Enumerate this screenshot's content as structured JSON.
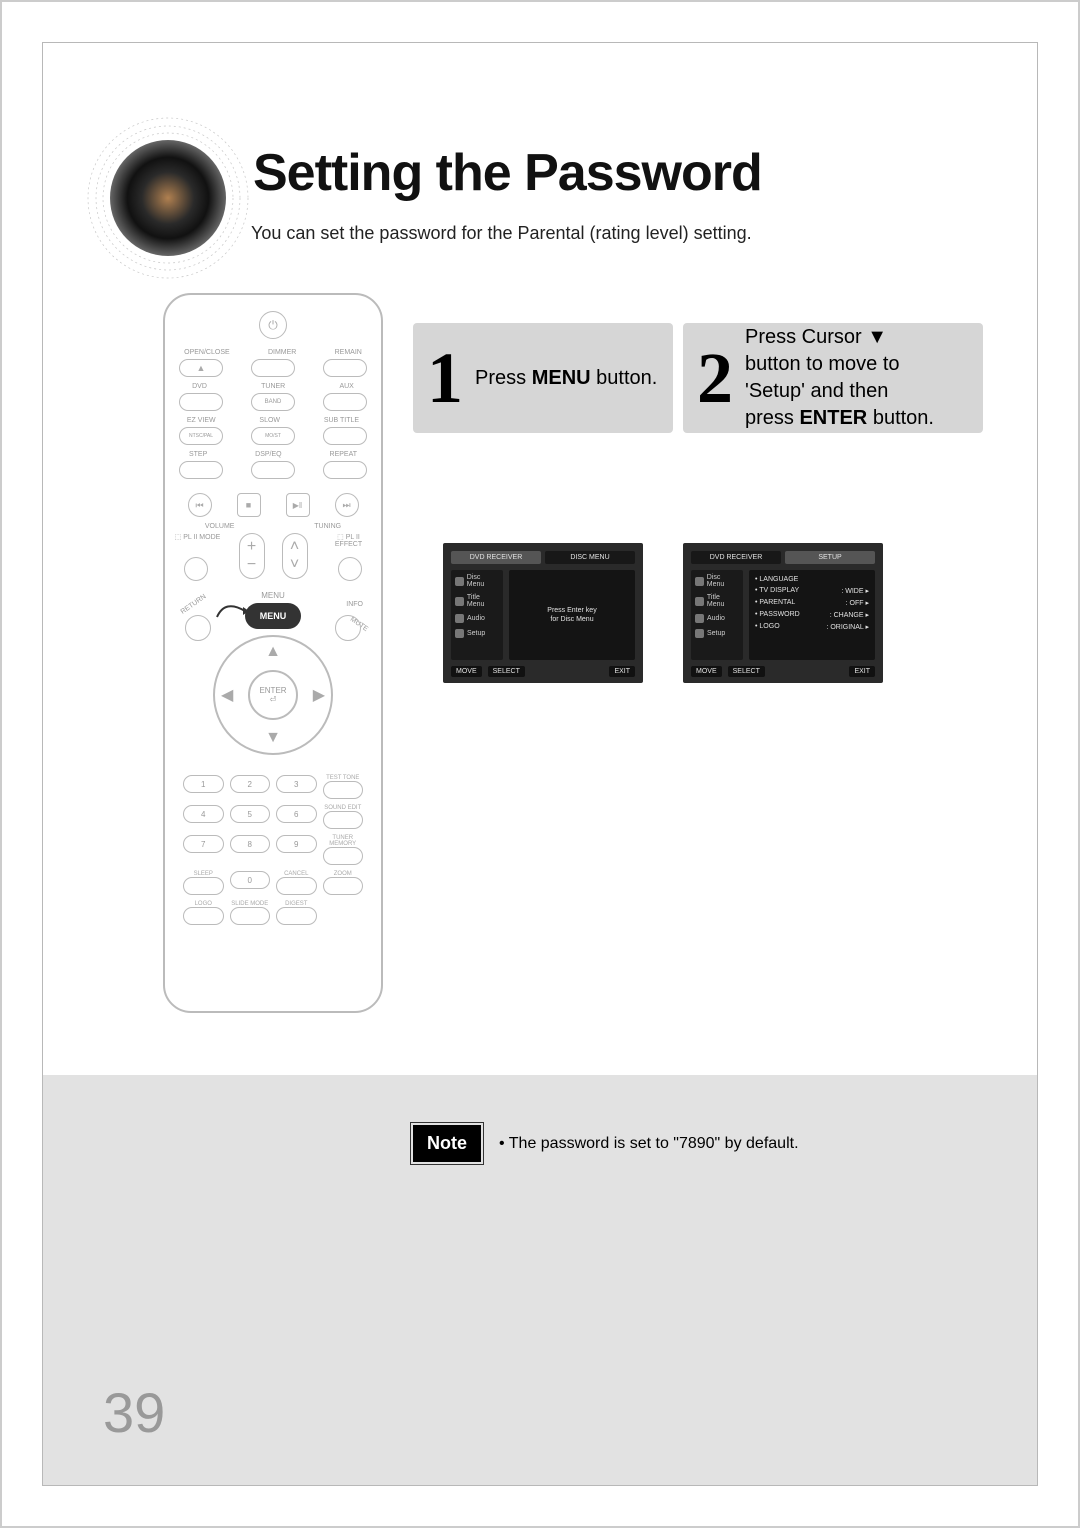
{
  "title": "Setting the Password",
  "subtitle": "You can set the password for the Parental (rating level) setting.",
  "steps": {
    "s1": {
      "num": "1",
      "pre": "Press ",
      "strong": "MENU",
      "post": " button."
    },
    "s2": {
      "num": "2",
      "line1": "Press Cursor ▼",
      "line2": "button to move to",
      "line3": "'Setup' and then",
      "line4_pre": "press ",
      "line4_strong": "ENTER",
      "line4_post": " button."
    }
  },
  "note": {
    "label": "Note",
    "bullet": "•",
    "text": "The password is set to \"7890\" by default."
  },
  "page_number": "39",
  "remote": {
    "power": "⏻",
    "row1": {
      "openclose": "OPEN/CLOSE",
      "dimmer": "DIMMER",
      "remain": "REMAIN"
    },
    "row2": {
      "dvd": "DVD",
      "tuner": "TUNER",
      "band": "BAND",
      "aux": "AUX"
    },
    "row3": {
      "ezview": "EZ VIEW",
      "ntscpal": "NTSC/PAL",
      "slow": "SLOW",
      "most": "MO/ST",
      "subtitle": "SUB TITLE"
    },
    "row4": {
      "step": "STEP",
      "dspeq": "DSP/EQ",
      "repeat": "REPEAT"
    },
    "transport": {
      "prev": "⏮",
      "stop": "■",
      "play": "▶‖",
      "next": "⏭"
    },
    "vol": {
      "volume": "VOLUME",
      "tuning": "TUNING",
      "pl2mode": "⬚ PL II MODE",
      "pl2eff": "⬚ PL II EFFECT"
    },
    "menu_area": {
      "return": "RETURN",
      "menu": "MENU",
      "info": "INFO",
      "mute": "MUTE",
      "enter": "ENTER"
    },
    "keypad": {
      "k1": "1",
      "k2": "2",
      "k3": "3",
      "testtone": "TEST TONE",
      "k4": "4",
      "k5": "5",
      "k6": "6",
      "soundedit": "SOUND EDIT",
      "k7": "7",
      "k8": "8",
      "k9": "9",
      "tunermem": "TUNER MEMORY",
      "sleep": "SLEEP",
      "k0": "0",
      "cancel": "CANCEL",
      "zoom": "ZOOM",
      "logo": "LOGO",
      "slidemode": "SLIDE MODE",
      "digest": "DIGEST"
    }
  },
  "screen1": {
    "tab_left": "DVD RECEIVER",
    "tab_right": "DISC MENU",
    "side": [
      "Disc Menu",
      "Title Menu",
      "Audio",
      "Setup"
    ],
    "line1": "Press Enter key",
    "line2": "for Disc Menu",
    "foot_move": "MOVE",
    "foot_select": "SELECT",
    "foot_exit": "EXIT"
  },
  "screen2": {
    "tab_left": "DVD RECEIVER",
    "tab_right": "SETUP",
    "side": [
      "Disc Menu",
      "Title Menu",
      "Audio",
      "Setup"
    ],
    "rows": [
      {
        "k": "LANGUAGE",
        "v": ""
      },
      {
        "k": "TV DISPLAY",
        "v": "WIDE"
      },
      {
        "k": "PARENTAL",
        "v": "OFF"
      },
      {
        "k": "PASSWORD",
        "v": "CHANGE"
      },
      {
        "k": "LOGO",
        "v": "ORIGINAL"
      }
    ],
    "foot_move": "MOVE",
    "foot_select": "SELECT",
    "foot_exit": "EXIT"
  }
}
